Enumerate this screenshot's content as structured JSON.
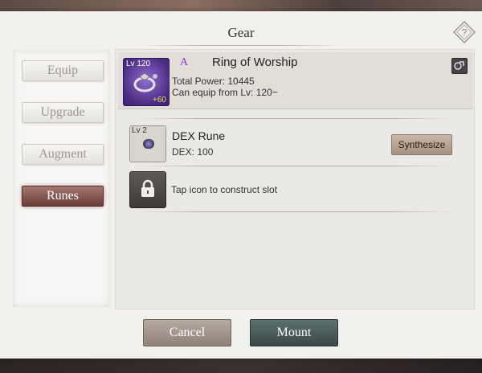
{
  "dialog": {
    "title": "Gear"
  },
  "icons": {
    "help": "help-diamond-icon",
    "compare": "compare-icon",
    "item": "ring-icon",
    "rune": "rune-gem-icon",
    "lock": "lock-icon"
  },
  "nav": {
    "tabs": [
      {
        "label": "Equip",
        "active": false
      },
      {
        "label": "Upgrade",
        "active": false
      },
      {
        "label": "Augment",
        "active": false
      },
      {
        "label": "Runes",
        "active": true
      }
    ]
  },
  "item": {
    "level": "Lv 120",
    "enhance": "+60",
    "grade": "A",
    "name": "Ring of Worship",
    "total_power": "Total Power: 10445",
    "equip_level": "Can equip from Lv: 120~"
  },
  "runes": {
    "slots": [
      {
        "level": "Lv 2",
        "name": "DEX Rune",
        "stat": "DEX: 100",
        "action_label": "Synthesize"
      }
    ],
    "locked_slot_text": "Tap icon to construct slot"
  },
  "buttons": {
    "cancel": "Cancel",
    "mount": "Mount"
  },
  "colors": {
    "panel_bg": "#f3f1ee",
    "active_tab": "#6a3d38",
    "grade_color": "#8a3bd2",
    "item_icon_bg": "#4d2f86"
  }
}
